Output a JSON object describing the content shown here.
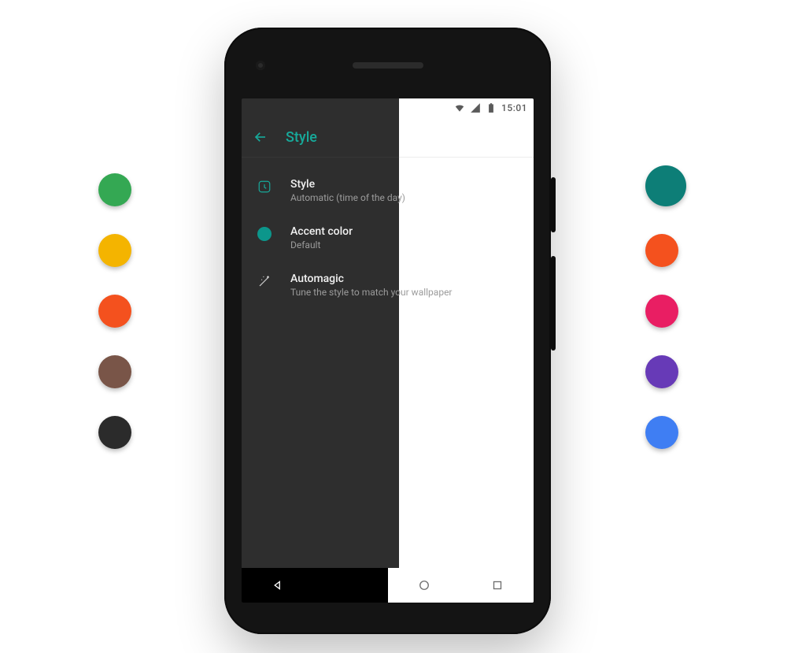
{
  "statusbar": {
    "time": "15:01"
  },
  "appbar": {
    "title": "Style"
  },
  "settings": {
    "style": {
      "label": "Style",
      "sub": "Automatic (time of the day)"
    },
    "accent": {
      "label": "Accent color",
      "sub": "Default"
    },
    "automagic": {
      "label": "Automagic",
      "sub": "Tune the style to match your wallpaper"
    }
  },
  "swatches": {
    "left": [
      "#34a853",
      "#f4b400",
      "#f4511e",
      "#795548",
      "#2b2b2b"
    ],
    "right": [
      "#0d7e77",
      "#f4511e",
      "#e91e63",
      "#673ab7",
      "#3f7ef3"
    ]
  },
  "colors": {
    "accent": "#17a99a",
    "accentDot": "#0c968b"
  }
}
